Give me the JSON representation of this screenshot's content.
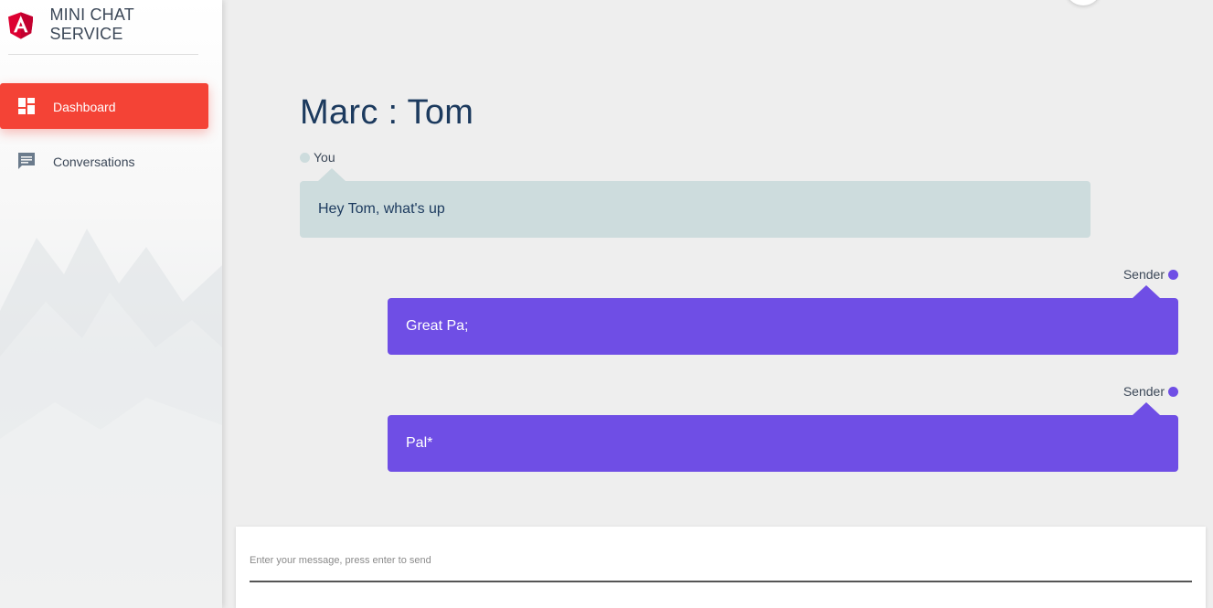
{
  "app": {
    "title": "MINI CHAT SERVICE",
    "logo_icon": "angular-logo-icon"
  },
  "sidebar": {
    "items": [
      {
        "label": "Dashboard",
        "icon": "dashboard-icon",
        "active": true
      },
      {
        "label": "Conversations",
        "icon": "chat-icon",
        "active": false
      }
    ]
  },
  "chat": {
    "title": "Marc : Tom",
    "messages": [
      {
        "author": "You",
        "text": "Hey Tom, what's up",
        "side": "left",
        "color": "#cddcdd"
      },
      {
        "author": "Sender",
        "text": "Great Pa;",
        "side": "right",
        "color": "#6f4ee5"
      },
      {
        "author": "Sender",
        "text": "Pal*",
        "side": "right",
        "color": "#6f4ee5"
      }
    ]
  },
  "composer": {
    "placeholder": "Enter your message, press enter to send",
    "value": ""
  },
  "colors": {
    "accent": "#f44336",
    "sender_bubble": "#6f4ee5",
    "you_bubble": "#cddcdd",
    "title_text": "#1c3a5e"
  }
}
